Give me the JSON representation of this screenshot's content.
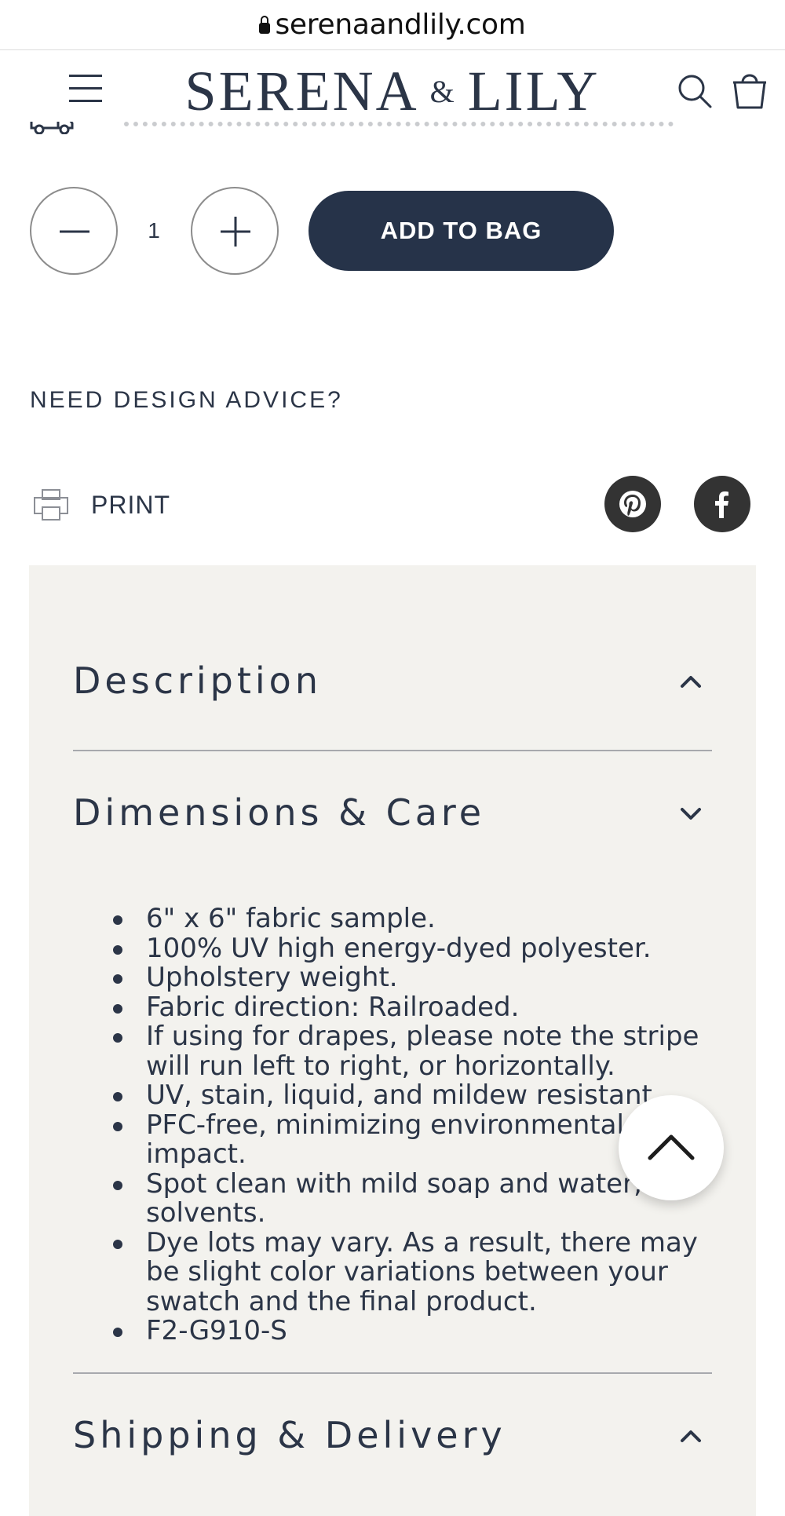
{
  "browser": {
    "url": "serenaandlily.com"
  },
  "header": {
    "brand_left": "SERENA",
    "brand_amp": "&",
    "brand_right": "LILY",
    "icons": [
      "menu-icon",
      "search-icon",
      "shopping-bag-icon"
    ]
  },
  "purchase": {
    "quantity": "1",
    "add_label": "ADD TO BAG"
  },
  "advice_label": "NEED DESIGN ADVICE?",
  "print_label": "PRINT",
  "social_icons": [
    "pinterest-icon",
    "facebook-icon"
  ],
  "accordion": {
    "description_title": "Description",
    "dimensions_title": "Dimensions & Care",
    "shipping_title": "Shipping & Delivery",
    "care_items": [
      "6\" x 6\" fabric sample.",
      "100% UV high energy-dyed polyester.",
      "Upholstery weight.",
      "Fabric direction: Railroaded.",
      "If using for drapes, please note the stripe will run left to right, or horizontally.",
      "UV, stain, liquid, and mildew resistant",
      "PFC-free, minimizing environmental impact.",
      "Spot clean with mild soap and water; no solvents.",
      "Dye lots may vary. As a result, there may be slight color variations between your swatch and the final product.",
      "F2-G910-S"
    ]
  },
  "colors": {
    "brand_navy": "#263349",
    "panel_bg": "#f3f2ee",
    "text": "#2b3547"
  }
}
